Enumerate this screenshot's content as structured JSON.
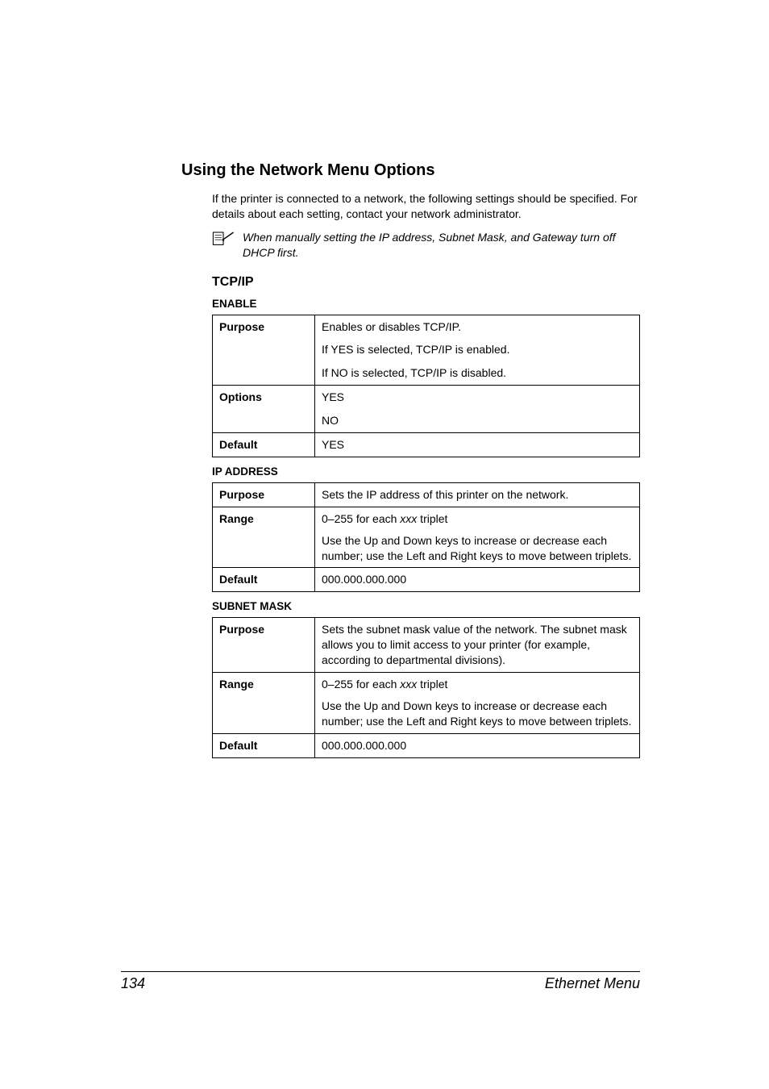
{
  "heading": "Using the Network Menu Options",
  "intro": "If the printer is connected to a network, the following settings should be specified. For details about each setting, contact your network administrator.",
  "note": "When manually setting the IP address, Subnet Mask, and Gateway turn off DHCP first.",
  "section_tcpip": "TCP/IP",
  "labels": {
    "purpose": "Purpose",
    "options": "Options",
    "default": "Default",
    "range": "Range"
  },
  "enable": {
    "title": "ENABLE",
    "purpose1": "Enables or disables TCP/IP.",
    "purpose2": "If YES is selected, TCP/IP is enabled.",
    "purpose3": "If NO is selected, TCP/IP is disabled.",
    "opt1": "YES",
    "opt2": "NO",
    "default": "YES"
  },
  "ipaddress": {
    "title": "IP ADDRESS",
    "purpose": "Sets the IP address of this printer on the network.",
    "range_prefix": "0–255 for each ",
    "range_ital": "xxx",
    "range_suffix": " triplet",
    "range2": "Use the Up and Down keys to increase or decrease each number; use the Left and Right keys to move between triplets.",
    "default": "000.000.000.000"
  },
  "subnet": {
    "title": "SUBNET MASK",
    "purpose": "Sets the subnet mask value of the network. The subnet mask allows you to limit access to your printer (for example, according to departmental divisions).",
    "range_prefix": "0–255 for each ",
    "range_ital": "xxx",
    "range_suffix": " triplet",
    "range2": "Use the Up and Down keys to increase or decrease each number; use the Left and Right keys to move between triplets.",
    "default": "000.000.000.000"
  },
  "footer": {
    "page": "134",
    "title": "Ethernet Menu"
  }
}
